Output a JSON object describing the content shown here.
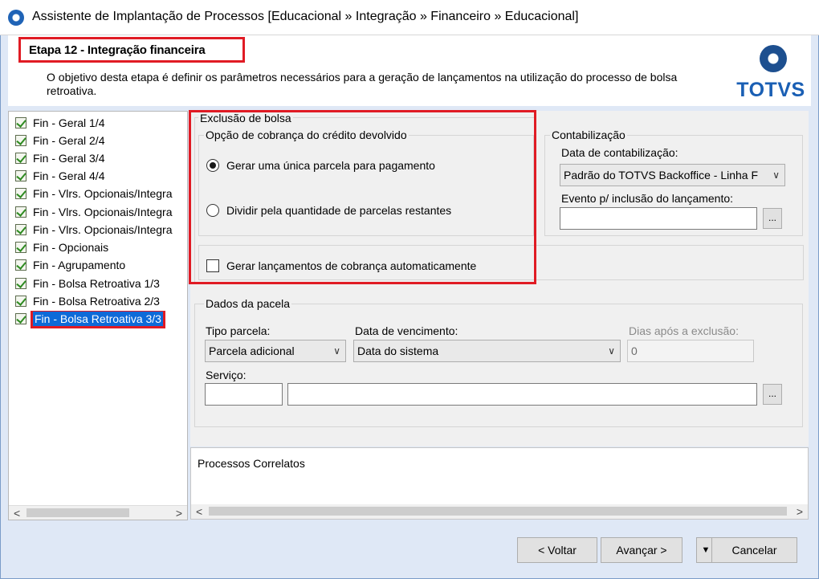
{
  "window": {
    "title": "Assistente de Implantação de Processos [Educacional » Integração » Financeiro » Educacional]"
  },
  "header": {
    "step_title": "Etapa 12 - Integração financeira",
    "description": "O objetivo desta etapa é definir os parâmetros necessários para a geração de lançamentos na utilização do processo de bolsa retroativa.",
    "logo_text": "TOTVS"
  },
  "tree": {
    "items": [
      {
        "label": "Fin - Geral 1/4"
      },
      {
        "label": "Fin - Geral 2/4"
      },
      {
        "label": "Fin - Geral 3/4"
      },
      {
        "label": "Fin - Geral 4/4"
      },
      {
        "label": "Fin - Vlrs. Opcionais/Integra"
      },
      {
        "label": "Fin - Vlrs. Opcionais/Integra"
      },
      {
        "label": "Fin - Vlrs. Opcionais/Integra"
      },
      {
        "label": "Fin - Opcionais"
      },
      {
        "label": "Fin - Agrupamento"
      },
      {
        "label": "Fin - Bolsa Retroativa 1/3"
      },
      {
        "label": "Fin - Bolsa Retroativa 2/3"
      },
      {
        "label": "Fin - Bolsa Retroativa 3/3"
      }
    ],
    "selected_index": 11
  },
  "exclusao": {
    "legend": "Exclusão de bolsa",
    "opcao_legend": "Opção de cobrança do crédito devolvido",
    "radio1_label": "Gerar uma única parcela para pagamento",
    "radio2_label": "Dividir pela quantidade de parcelas restantes",
    "checkbox_label": "Gerar lançamentos de cobrança automaticamente"
  },
  "contabilizacao": {
    "legend": "Contabilização",
    "data_label": "Data de contabilização:",
    "data_value": "Padrão do TOTVS Backoffice - Linha F",
    "evento_label": "Evento p/ inclusão do lançamento:",
    "evento_value": "",
    "ellipsis": "..."
  },
  "dados": {
    "legend": "Dados da pacela",
    "tipo_label": "Tipo parcela:",
    "tipo_value": "Parcela adicional",
    "venc_label": "Data de vencimento:",
    "venc_value": "Data do sistema",
    "dias_label": "Dias após a exclusão:",
    "dias_value": "0",
    "servico_label": "Serviço:",
    "servico_code": "",
    "servico_desc": "",
    "ellipsis": "..."
  },
  "related": {
    "label": "Processos Correlatos"
  },
  "buttons": {
    "back": "< Voltar",
    "next": "Avançar >",
    "cancel": "Cancelar"
  },
  "colors": {
    "highlight_red": "#e01b24",
    "selection_blue": "#0e6ad8",
    "logo_blue": "#1a5fb4"
  }
}
